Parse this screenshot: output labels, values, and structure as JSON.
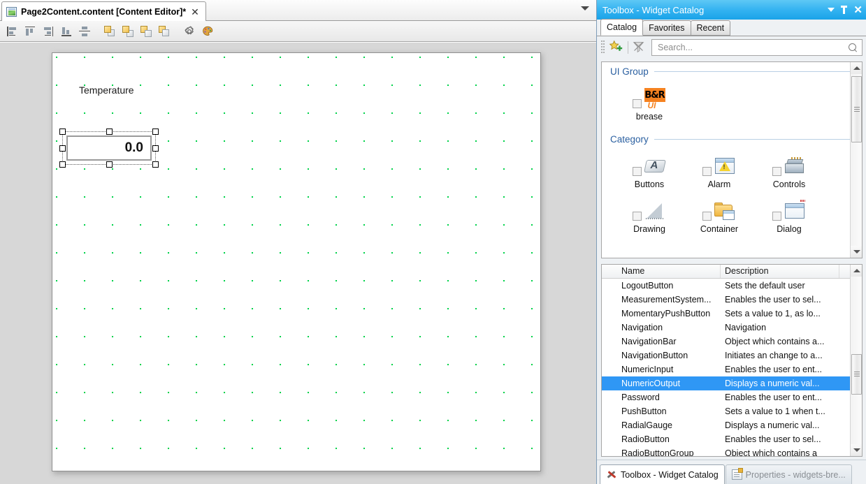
{
  "editor": {
    "tab_title": "Page2Content.content [Content Editor]*",
    "tab_icon": "content-document-icon",
    "close_label": "✕",
    "toolbar_buttons": [
      {
        "name": "align-left-icon",
        "label": "Align Left"
      },
      {
        "name": "align-top-icon",
        "label": "Align Top"
      },
      {
        "name": "align-right-icon",
        "label": "Align Right"
      },
      {
        "name": "align-bottom-icon",
        "label": "Align Bottom"
      },
      {
        "name": "distribute-vertical-icon",
        "label": "Distribute Vertically"
      },
      {
        "name": "bring-to-front-icon",
        "label": "Bring To Front"
      },
      {
        "name": "bring-forward-icon",
        "label": "Bring Forward"
      },
      {
        "name": "send-backward-icon",
        "label": "Send Backward"
      },
      {
        "name": "send-to-back-icon",
        "label": "Send To Back"
      },
      {
        "name": "settings-gear-icon",
        "label": "Settings"
      },
      {
        "name": "palette-icon",
        "label": "Style / Theme"
      }
    ],
    "canvas": {
      "label_text": "Temperature",
      "numeric_output_value": "0.0",
      "grid_dot_color": "#00d24a",
      "selection_state": "selected"
    }
  },
  "toolbox": {
    "title": "Toolbox - Widget Catalog",
    "title_buttons": {
      "dropdown": "▼",
      "pin": "pin",
      "close": "✕"
    },
    "tabs": [
      {
        "label": "Catalog",
        "active": true
      },
      {
        "label": "Favorites",
        "active": false
      },
      {
        "label": "Recent",
        "active": false
      }
    ],
    "search": {
      "placeholder": "Search...",
      "value": "",
      "add_favorite_icon": "star-add-icon",
      "clear_filter_icon": "filter-clear-icon",
      "search_icon": "magnifier-icon"
    },
    "sections": [
      {
        "title": "UI Group",
        "items": [
          {
            "label": "brease",
            "icon": "brease-ui-logo-icon",
            "checked": false
          }
        ]
      },
      {
        "title": "Category",
        "items": [
          {
            "label": "Buttons",
            "icon": "buttons-category-icon",
            "checked": false
          },
          {
            "label": "Alarm",
            "icon": "alarm-category-icon",
            "checked": false
          },
          {
            "label": "Controls",
            "icon": "controls-category-icon",
            "checked": false
          },
          {
            "label": "Drawing",
            "icon": "drawing-category-icon",
            "checked": false
          },
          {
            "label": "Container",
            "icon": "container-category-icon",
            "checked": false
          },
          {
            "label": "Dialog",
            "icon": "dialog-category-icon",
            "checked": false
          }
        ]
      }
    ],
    "list": {
      "columns": [
        "Name",
        "Description"
      ],
      "rows": [
        {
          "name": "LogoutButton",
          "description": "Sets the default user",
          "selected": false
        },
        {
          "name": "MeasurementSystem...",
          "description": "Enables the user to sel...",
          "selected": false
        },
        {
          "name": "MomentaryPushButton",
          "description": "Sets a value to 1, as lo...",
          "selected": false
        },
        {
          "name": "Navigation",
          "description": "Navigation",
          "selected": false
        },
        {
          "name": "NavigationBar",
          "description": "Object which contains a...",
          "selected": false
        },
        {
          "name": "NavigationButton",
          "description": "Initiates an change to a...",
          "selected": false
        },
        {
          "name": "NumericInput",
          "description": "Enables the user to ent...",
          "selected": false
        },
        {
          "name": "NumericOutput",
          "description": "Displays a numeric val...",
          "selected": true
        },
        {
          "name": "Password",
          "description": "Enables the user to ent...",
          "selected": false
        },
        {
          "name": "PushButton",
          "description": "Sets a value to 1 when t...",
          "selected": false
        },
        {
          "name": "RadialGauge",
          "description": "Displays a numeric val...",
          "selected": false
        },
        {
          "name": "RadioButton",
          "description": "Enables the user to sel...",
          "selected": false
        },
        {
          "name": "RadioButtonGroup",
          "description": "Object which contains a",
          "selected": false
        }
      ],
      "selection_color": "#2f97f5"
    },
    "bottom_tabs": [
      {
        "label": "Toolbox - Widget Catalog",
        "icon": "toolbox-wrench-icon",
        "active": true
      },
      {
        "label": "Properties - widgets-bre...",
        "icon": "properties-page-icon",
        "active": false
      }
    ]
  },
  "theme": {
    "title_bar_blue": "#34b3f1",
    "panel_bg": "#eef1f4",
    "canvas_bg": "#ffffff",
    "workspace_bg": "#d7d7d7",
    "section_heading_color": "#2a5fa0"
  }
}
